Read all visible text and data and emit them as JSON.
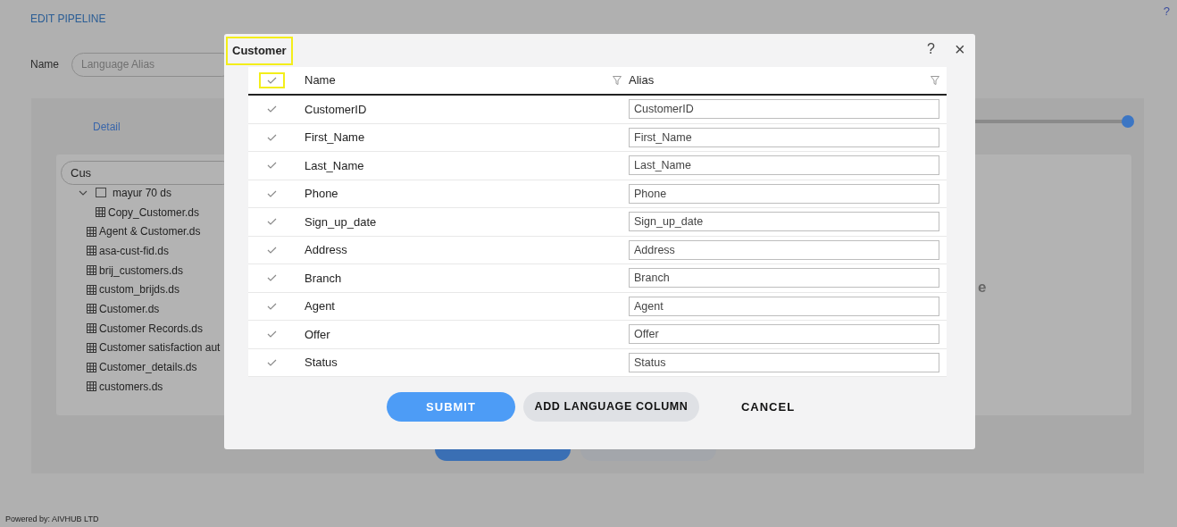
{
  "page": {
    "title": "EDIT PIPELINE",
    "help": "?",
    "name_label": "Name",
    "name_placeholder": "Language Alias"
  },
  "tabs": [
    {
      "label": "Detail",
      "selected": true
    }
  ],
  "tree_search": {
    "value": "Cus"
  },
  "tree": [
    {
      "label": "mayur 70 ds",
      "kind": "folder",
      "expanded": true,
      "children": [
        {
          "label": "Copy_Customer.ds",
          "kind": "table"
        }
      ]
    },
    {
      "label": "Agent & Customer.ds",
      "kind": "table"
    },
    {
      "label": "asa-cust-fid.ds",
      "kind": "table"
    },
    {
      "label": "brij_customers.ds",
      "kind": "table"
    },
    {
      "label": "custom_brijds.ds",
      "kind": "table"
    },
    {
      "label": "Customer.ds",
      "kind": "table"
    },
    {
      "label": "Customer Records.ds",
      "kind": "table"
    },
    {
      "label": "Customer satisfaction aut",
      "kind": "table"
    },
    {
      "label": "Customer_details.ds",
      "kind": "table"
    },
    {
      "label": "customers.ds",
      "kind": "table"
    }
  ],
  "partial_heading": "e",
  "footer": "Powered by: AIVHUB LTD",
  "dialog": {
    "title": "Customer",
    "help": "?",
    "close": "×",
    "header": {
      "checked": true,
      "columns": [
        "Name",
        "Alias"
      ]
    },
    "rows": [
      {
        "name": "CustomerID",
        "alias": "CustomerID",
        "checked": true
      },
      {
        "name": "First_Name",
        "alias": "First_Name",
        "checked": true
      },
      {
        "name": "Last_Name",
        "alias": "Last_Name",
        "checked": true
      },
      {
        "name": "Phone",
        "alias": "Phone",
        "checked": true
      },
      {
        "name": "Sign_up_date",
        "alias": "Sign_up_date",
        "checked": true
      },
      {
        "name": "Address",
        "alias": "Address",
        "checked": true
      },
      {
        "name": "Branch",
        "alias": "Branch",
        "checked": true
      },
      {
        "name": "Agent",
        "alias": "Agent",
        "checked": true
      },
      {
        "name": "Offer",
        "alias": "Offer",
        "checked": true
      },
      {
        "name": "Status",
        "alias": "Status",
        "checked": true
      }
    ],
    "buttons": [
      {
        "label": "SUBMIT",
        "kind": "primary"
      },
      {
        "label": "ADD LANGUAGE COLUMN",
        "kind": "secondary"
      },
      {
        "label": "CANCEL",
        "kind": "text"
      }
    ]
  }
}
